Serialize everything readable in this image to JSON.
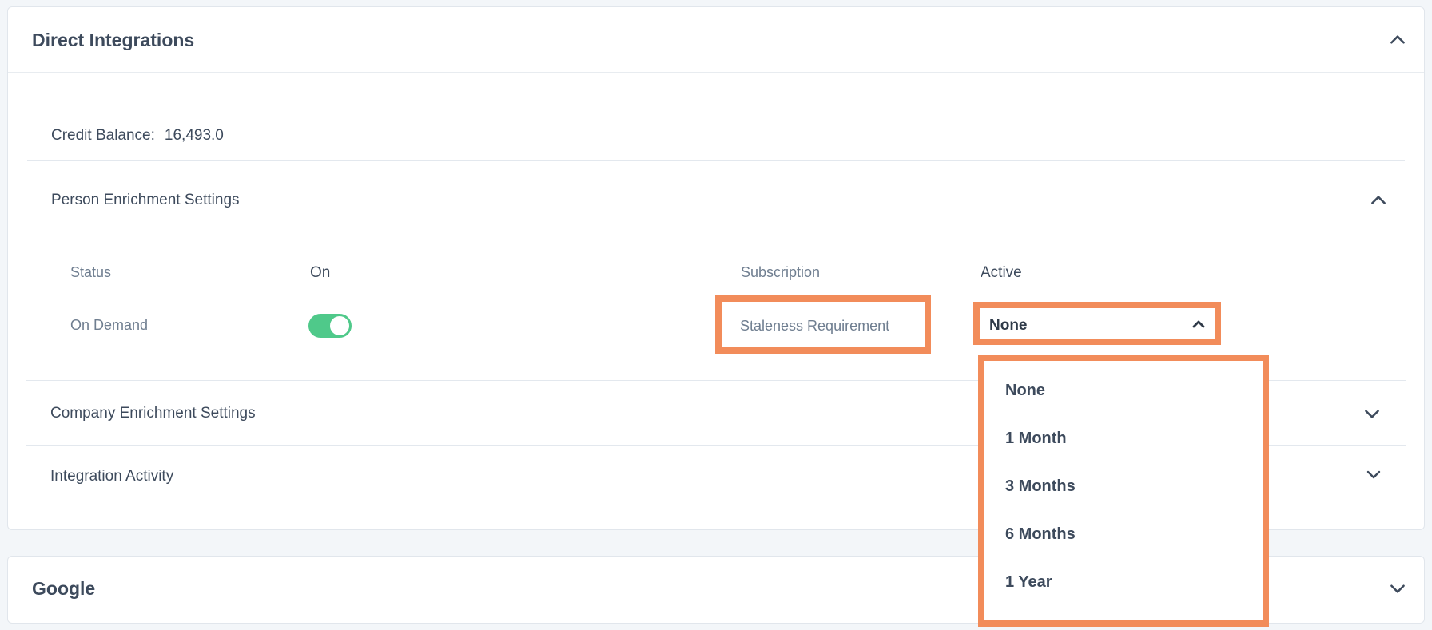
{
  "direct_integrations": {
    "title": "Direct Integrations",
    "credit_balance_label": "Credit Balance:",
    "credit_balance_value": "16,493.0",
    "person_enrichment": {
      "title": "Person Enrichment Settings",
      "status_label": "Status",
      "status_value": "On",
      "subscription_label": "Subscription",
      "subscription_value": "Active",
      "on_demand_label": "On Demand",
      "on_demand_enabled": true,
      "staleness_label": "Staleness Requirement",
      "staleness_value": "None",
      "staleness_options": [
        "None",
        "1 Month",
        "3 Months",
        "6 Months",
        "1 Year"
      ]
    },
    "company_enrichment_title": "Company Enrichment Settings",
    "integration_activity_title": "Integration Activity"
  },
  "google": {
    "title": "Google"
  },
  "colors": {
    "highlight": "#f28c5a",
    "toggle_on": "#4fc98a",
    "background": "#f3f6f9"
  },
  "icons": {
    "expand": "chevron-down-icon",
    "collapse": "chevron-up-icon"
  }
}
